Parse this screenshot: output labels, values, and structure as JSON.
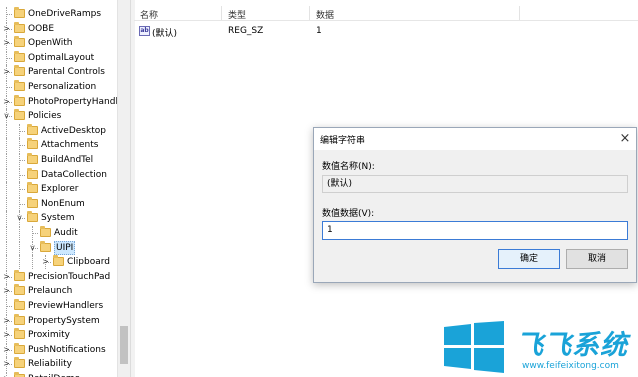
{
  "tree": {
    "items": [
      {
        "label": "OneDriveRamps",
        "expand": "",
        "selected": false
      },
      {
        "label": "OOBE",
        "expand": ">",
        "selected": false
      },
      {
        "label": "OpenWith",
        "expand": ">",
        "selected": false
      },
      {
        "label": "OptimalLayout",
        "expand": "",
        "selected": false
      },
      {
        "label": "Parental Controls",
        "expand": ">",
        "selected": false
      },
      {
        "label": "Personalization",
        "expand": "",
        "selected": false
      },
      {
        "label": "PhotoPropertyHandle",
        "expand": ">",
        "selected": false
      },
      {
        "label": "Policies",
        "expand": "v",
        "selected": false
      },
      {
        "label": "ActiveDesktop",
        "expand": "",
        "selected": false
      },
      {
        "label": "Attachments",
        "expand": "",
        "selected": false
      },
      {
        "label": "BuildAndTel",
        "expand": "",
        "selected": false
      },
      {
        "label": "DataCollection",
        "expand": "",
        "selected": false
      },
      {
        "label": "Explorer",
        "expand": "",
        "selected": false
      },
      {
        "label": "NonEnum",
        "expand": "",
        "selected": false
      },
      {
        "label": "System",
        "expand": "v",
        "selected": false
      },
      {
        "label": "Audit",
        "expand": "",
        "selected": false
      },
      {
        "label": "UIPI",
        "expand": "v",
        "selected": true
      },
      {
        "label": "Clipboard",
        "expand": ">",
        "selected": false
      },
      {
        "label": "PrecisionTouchPad",
        "expand": ">",
        "selected": false
      },
      {
        "label": "Prelaunch",
        "expand": ">",
        "selected": false
      },
      {
        "label": "PreviewHandlers",
        "expand": "",
        "selected": false
      },
      {
        "label": "PropertySystem",
        "expand": ">",
        "selected": false
      },
      {
        "label": "Proximity",
        "expand": ">",
        "selected": false
      },
      {
        "label": "PushNotifications",
        "expand": ">",
        "selected": false
      },
      {
        "label": "Reliability",
        "expand": ">",
        "selected": false
      },
      {
        "label": "RetailDemo",
        "expand": ">",
        "selected": false
      }
    ]
  },
  "list": {
    "headers": {
      "name": "名称",
      "type": "类型",
      "data": "数据"
    },
    "rows": [
      {
        "icon": "ab",
        "name": "(默认)",
        "type": "REG_SZ",
        "data": "1"
      }
    ]
  },
  "dialog": {
    "title": "编辑字符串",
    "close_icon": "×",
    "name_label": "数值名称(N):",
    "name_value": "(默认)",
    "data_label": "数值数据(V):",
    "data_value": "1",
    "ok_label": "确定",
    "cancel_label": "取消"
  },
  "watermark": {
    "brand": "飞飞系统",
    "url": "www.feifeixitong.com",
    "color": "#1aa3d8"
  }
}
